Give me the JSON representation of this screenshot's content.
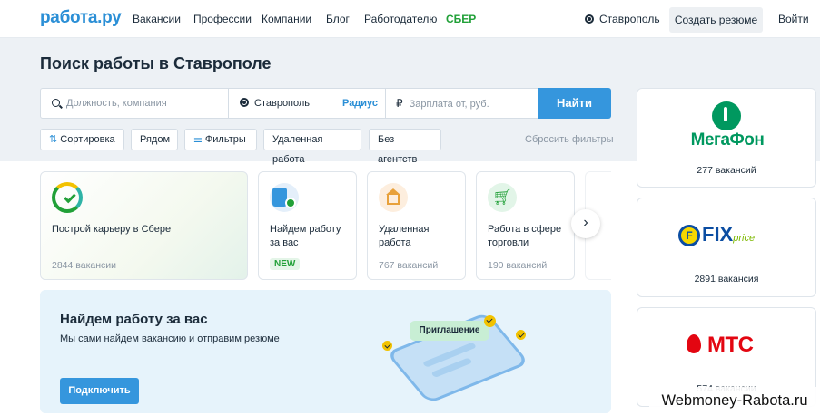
{
  "header": {
    "logo": "работа.ру",
    "nav": [
      "Вакансии",
      "Профессии",
      "Компании",
      "Блог",
      "Работодателю",
      "СБЕР"
    ],
    "city": "Ставрополь",
    "create_resume": "Создать резюме",
    "login": "Войти"
  },
  "search": {
    "title": "Поиск работы в Ставрополе",
    "job_placeholder": "Должность, компания",
    "city_value": "Ставрополь",
    "radius": "Радиус",
    "salary_placeholder": "Зарплата от, руб.",
    "find_button": "Найти"
  },
  "filters": {
    "chips": [
      "Сортировка",
      "Рядом",
      "Фильтры",
      "Удаленная работа",
      "Без агентств"
    ],
    "reset": "Сбросить фильтры"
  },
  "categories": [
    {
      "title": "Построй карьеру в Сбере",
      "count": "2844 вакансии",
      "icon": "sber-logo-icon"
    },
    {
      "title_line1": "Найдем работу",
      "title_line2": "за вас",
      "badge": "NEW",
      "icon": "resume-check-icon"
    },
    {
      "title_line1": "Удаленная",
      "title_line2": "работа",
      "count": "767 вакансий",
      "icon": "house-icon"
    },
    {
      "title_line1": "Работа в сфере",
      "title_line2": "торговли",
      "count": "190 вакансий",
      "icon": "cart-icon"
    }
  ],
  "promo": {
    "title": "Найдем работу за вас",
    "subtitle": "Мы сами найдем вакансию и отправим резюме",
    "button": "Подключить",
    "invite_label": "Приглашение"
  },
  "employers": [
    {
      "name": "МегаФон",
      "count": "277 вакансий"
    },
    {
      "name": "FIX",
      "name_suffix": "price",
      "count": "2891 вакансия"
    },
    {
      "name": "МТС",
      "count": "574 вакансии"
    }
  ],
  "watermark": "Webmoney-Rabota.ru",
  "colors": {
    "accent": "#3596dd",
    "sber": "#21a038",
    "megafon": "#00985f",
    "mts": "#e30611",
    "fix": "#0b4da2"
  }
}
